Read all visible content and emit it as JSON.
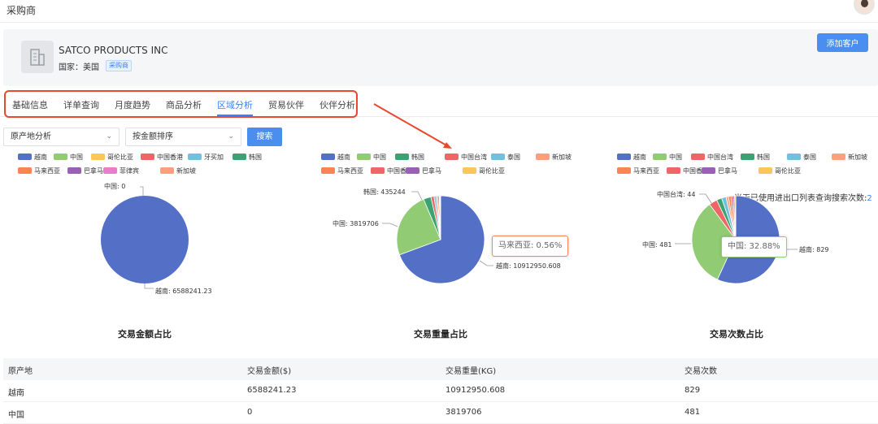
{
  "header": {
    "title": "采购商"
  },
  "company": {
    "name": "SATCO PRODUCTS INC",
    "country_label": "国家：美国",
    "tag": "采购商",
    "add_button": "添加客户"
  },
  "tabs": [
    {
      "label": "基础信息",
      "active": false
    },
    {
      "label": "详单查询",
      "active": false
    },
    {
      "label": "月度趋势",
      "active": false
    },
    {
      "label": "商品分析",
      "active": false
    },
    {
      "label": "区域分析",
      "active": true
    },
    {
      "label": "贸易伙伴",
      "active": false
    },
    {
      "label": "伙伴分析",
      "active": false
    }
  ],
  "quota_text": "当天已使用进出口列表查询搜索次数:",
  "quota_value": "2",
  "filters": {
    "analysis": "原产地分析",
    "sort": "按金额排序",
    "search_button": "搜索"
  },
  "colors": {
    "越南": "#5470c6",
    "中国": "#91cc75",
    "哥伦比亚": "#fac858",
    "中国香港": "#ee6666",
    "牙买加": "#73c0de",
    "韩国": "#3ba272",
    "马来西亚": "#fc8452",
    "巴拿马": "#9a60b4",
    "菲律宾": "#ea7ccc",
    "新加坡": "#ff9f7f",
    "中国台湾": "#ee6666",
    "泰国": "#73c0de"
  },
  "chart_data": [
    {
      "type": "pie",
      "title": "交易金额占比",
      "legend": [
        "越南",
        "中国",
        "哥伦比亚",
        "中国香港",
        "牙买加",
        "韩国",
        "马来西亚",
        "巴拿马",
        "菲律宾",
        "新加坡"
      ],
      "slices": [
        {
          "name": "越南",
          "value": 6588241.23
        },
        {
          "name": "中国",
          "value": 0
        }
      ],
      "labels": [
        {
          "text": "中国: 0"
        },
        {
          "text": "越南: 6588241.23"
        }
      ]
    },
    {
      "type": "pie",
      "title": "交易重量占比",
      "legend": [
        "越南",
        "中国",
        "韩国",
        "中国台湾",
        "泰国",
        "新加坡",
        "马来西亚",
        "中国香港",
        "巴拿马",
        "哥伦比亚"
      ],
      "slices": [
        {
          "name": "越南",
          "value": 10912950.608
        },
        {
          "name": "中国",
          "value": 3819706
        },
        {
          "name": "韩国",
          "value": 435244
        },
        {
          "name": "中国台湾",
          "value": 180000
        },
        {
          "name": "泰国",
          "value": 120000
        },
        {
          "name": "新加坡",
          "value": 95000
        },
        {
          "name": "马来西亚",
          "value": 88000
        },
        {
          "name": "中国香港",
          "value": 40000
        },
        {
          "name": "巴拿马",
          "value": 25000
        },
        {
          "name": "哥伦比亚",
          "value": 15000
        }
      ],
      "labels": [
        {
          "text": "韩国: 435244"
        },
        {
          "text": "中国: 3819706"
        },
        {
          "text": "越南: 10912950.608"
        }
      ],
      "tooltip": "马来西亚: 0.56%"
    },
    {
      "type": "pie",
      "title": "交易次数占比",
      "legend": [
        "越南",
        "中国",
        "中国台湾",
        "韩国",
        "泰国",
        "新加坡",
        "马来西亚",
        "中国香港",
        "巴拿马",
        "哥伦比亚"
      ],
      "slices": [
        {
          "name": "越南",
          "value": 829
        },
        {
          "name": "中国",
          "value": 481
        },
        {
          "name": "中国台湾",
          "value": 44
        },
        {
          "name": "韩国",
          "value": 28
        },
        {
          "name": "泰国",
          "value": 24
        },
        {
          "name": "新加坡",
          "value": 13
        },
        {
          "name": "马来西亚",
          "value": 14
        },
        {
          "name": "中国香港",
          "value": 11
        },
        {
          "name": "巴拿马",
          "value": 8
        },
        {
          "name": "哥伦比亚",
          "value": 6
        }
      ],
      "labels": [
        {
          "text": "中国台湾: 44"
        },
        {
          "text": "中国: 481"
        },
        {
          "text": "越南: 829"
        }
      ],
      "tooltip": "中国: 32.88%"
    }
  ],
  "table": {
    "headers": [
      "原产地",
      "交易金额($)",
      "交易重量(KG)",
      "交易次数"
    ],
    "rows": [
      [
        "越南",
        "6588241.23",
        "10912950.608",
        "829"
      ],
      [
        "中国",
        "0",
        "3819706",
        "481"
      ]
    ]
  }
}
